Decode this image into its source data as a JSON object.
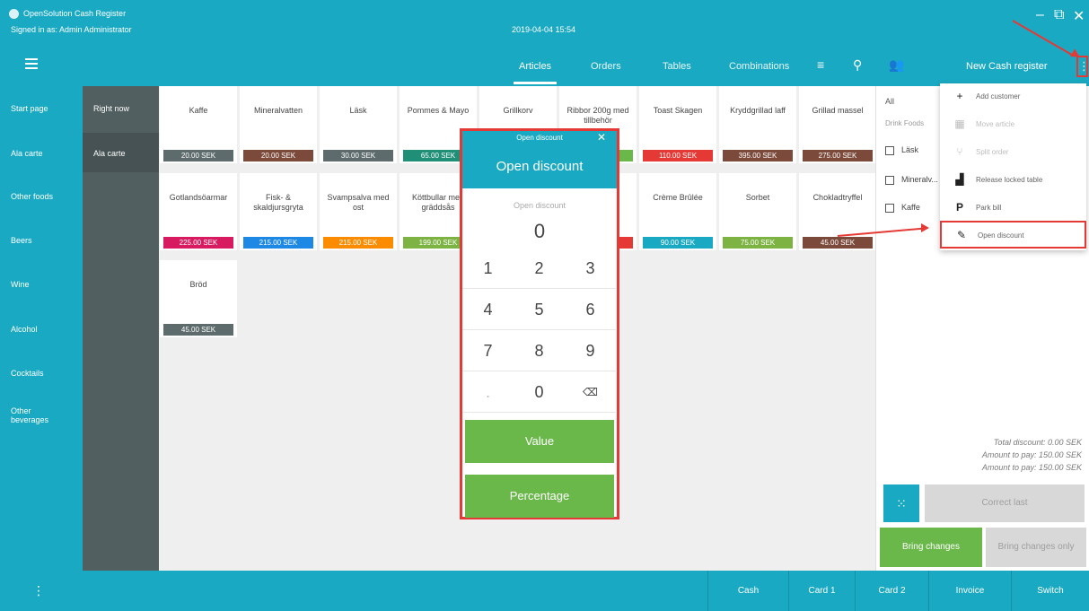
{
  "window": {
    "app_title": "OpenSolution Cash Register",
    "signed_in": "Signed in as: Admin Administrator",
    "datetime": "2019-04-04 15:54"
  },
  "nav": {
    "tabs": [
      "Articles",
      "Orders",
      "Tables",
      "Combinations"
    ],
    "active_tab": "Articles",
    "panel_title": "New Cash register"
  },
  "categories": [
    "Start page",
    "Ala carte",
    "Other foods",
    "Beers",
    "Wine",
    "Alcohol",
    "Cocktails",
    "Other beverages"
  ],
  "subcategories": [
    "Right now",
    "Ala carte"
  ],
  "articles": [
    {
      "name": "Kaffe",
      "price": "20.00 SEK",
      "color": "#5d6b6c"
    },
    {
      "name": "Mineralvatten",
      "price": "20.00 SEK",
      "color": "#7b4a3a"
    },
    {
      "name": "Läsk",
      "price": "30.00 SEK",
      "color": "#5d6b6c"
    },
    {
      "name": "Pommes & Mayo",
      "price": "65.00 SEK",
      "color": "#1f8f78"
    },
    {
      "name": "Grillkorv",
      "price": "",
      "color": "#6ab84a"
    },
    {
      "name": "Ribbor 200g med tillbehör",
      "price": "",
      "color": "#6ab84a"
    },
    {
      "name": "Toast Skagen",
      "price": "110.00 SEK",
      "color": "#e53935"
    },
    {
      "name": "Kryddgrillad laff",
      "price": "395.00 SEK",
      "color": "#7b4a3a"
    },
    {
      "name": "Grillad massel",
      "price": "275.00 SEK",
      "color": "#7b4a3a"
    },
    {
      "name": "Gotlandsöarmar",
      "price": "225.00 SEK",
      "color": "#d81b60"
    },
    {
      "name": "Fisk- & skaldjursgryta",
      "price": "215.00 SEK",
      "color": "#1e88e5"
    },
    {
      "name": "Svampsalva med ost",
      "price": "215.00 SEK",
      "color": "#fb8c00"
    },
    {
      "name": "Köttbullar med gräddsås",
      "price": "199.00 SEK",
      "color": "#7cb342"
    },
    {
      "name": "",
      "price": "",
      "color": "#e53935"
    },
    {
      "name": "",
      "price": "",
      "color": "#e53935"
    },
    {
      "name": "Crème Brûlée",
      "price": "90.00 SEK",
      "color": "#1aa9c2"
    },
    {
      "name": "Sorbet",
      "price": "75.00 SEK",
      "color": "#7cb342"
    },
    {
      "name": "Chokladtryffel",
      "price": "45.00 SEK",
      "color": "#7b4a3a"
    },
    {
      "name": "Bröd",
      "price": "45.00 SEK",
      "color": "#5d6b6c"
    }
  ],
  "order_panel": {
    "tab": "All",
    "sub_labels": "Drink  Foods",
    "rows": [
      "Läsk",
      "Mineralv...",
      "Kaffe"
    ],
    "totals": {
      "total_discount": "Total discount: 0.00 SEK",
      "amount_to_pay": "Amount to pay: 150.00 SEK",
      "amount_to_pay_2": "Amount to pay: 150.00 SEK"
    },
    "correct_last": "Correct last",
    "bring_changes": "Bring changes",
    "bring_changes_only": "Bring changes only"
  },
  "menu": [
    {
      "icon": "+",
      "label": "Add customer"
    },
    {
      "icon": "▦",
      "label": "Move article"
    },
    {
      "icon": "⑂",
      "label": "Split order"
    },
    {
      "icon": "▟",
      "label": "Release locked table"
    },
    {
      "icon": "P",
      "label": "Park bill"
    },
    {
      "icon": "✎",
      "label": "Open discount"
    }
  ],
  "modal": {
    "header": "Open discount",
    "title": "Open discount",
    "placeholder": "Open discount",
    "value": "0",
    "keys": [
      "1",
      "2",
      "3",
      "4",
      "5",
      "6",
      "7",
      "8",
      "9",
      ".",
      "0",
      "⌫"
    ],
    "value_button": "Value",
    "percentage_button": "Percentage"
  },
  "bottom": {
    "buttons": [
      "Cash",
      "Card 1",
      "Card 2",
      "Invoice",
      "Switch"
    ]
  }
}
